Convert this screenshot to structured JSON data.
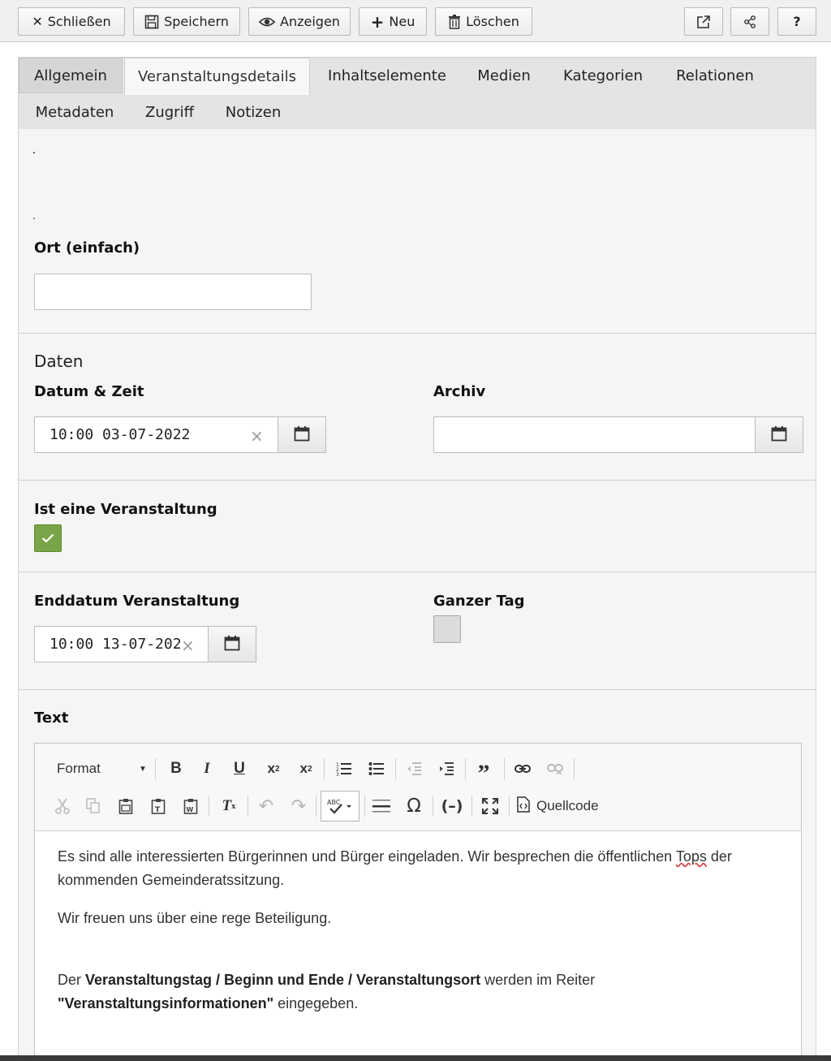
{
  "toolbar": {
    "close": "Schließen",
    "save": "Speichern",
    "view": "Anzeigen",
    "new": "Neu",
    "delete": "Löschen",
    "help": "?"
  },
  "tabs": {
    "row1": [
      "Allgemein",
      "Veranstaltungsdetails",
      "Inhaltselemente",
      "Medien",
      "Kategorien",
      "Relationen"
    ],
    "row2": [
      "Metadaten",
      "Zugriff",
      "Notizen"
    ],
    "active": "Veranstaltungsdetails"
  },
  "form": {
    "ort_label": "Ort (einfach)",
    "ort_value": "",
    "daten_heading": "Daten",
    "datetime_label": "Datum & Zeit",
    "datetime_value": "10:00 03-07-2022",
    "archive_label": "Archiv",
    "archive_value": "",
    "is_event_label": "Ist eine Veranstaltung",
    "is_event_checked": true,
    "end_label": "Enddatum Veranstaltung",
    "end_value": "10:00 13-07-202",
    "fullday_label": "Ganzer Tag",
    "fullday_checked": false,
    "text_label": "Text"
  },
  "editor": {
    "format_label": "Format",
    "source_label": "Quellcode",
    "p1_a": "Es sind alle interessierten Bürgerinnen und Bürger eingeladen. Wir besprechen die öffentlichen ",
    "p1_b": "Tops",
    "p1_c": " der kommenden Gemeinderatssitzung.",
    "p2": "Wir freuen uns über eine rege Beteiligung.",
    "p3_a": "Der ",
    "p3_b": "Veranstaltungstag / Beginn und Ende / Veranstaltungsort",
    "p3_c": " werden im Reiter ",
    "p3_d": "\"Veranstaltungsinformationen\"",
    "p3_e": " eingegeben."
  },
  "colors": {
    "check_green": "#79a548",
    "panel_bg": "#f5f5f5",
    "tab_bg": "#e4e4e4"
  }
}
